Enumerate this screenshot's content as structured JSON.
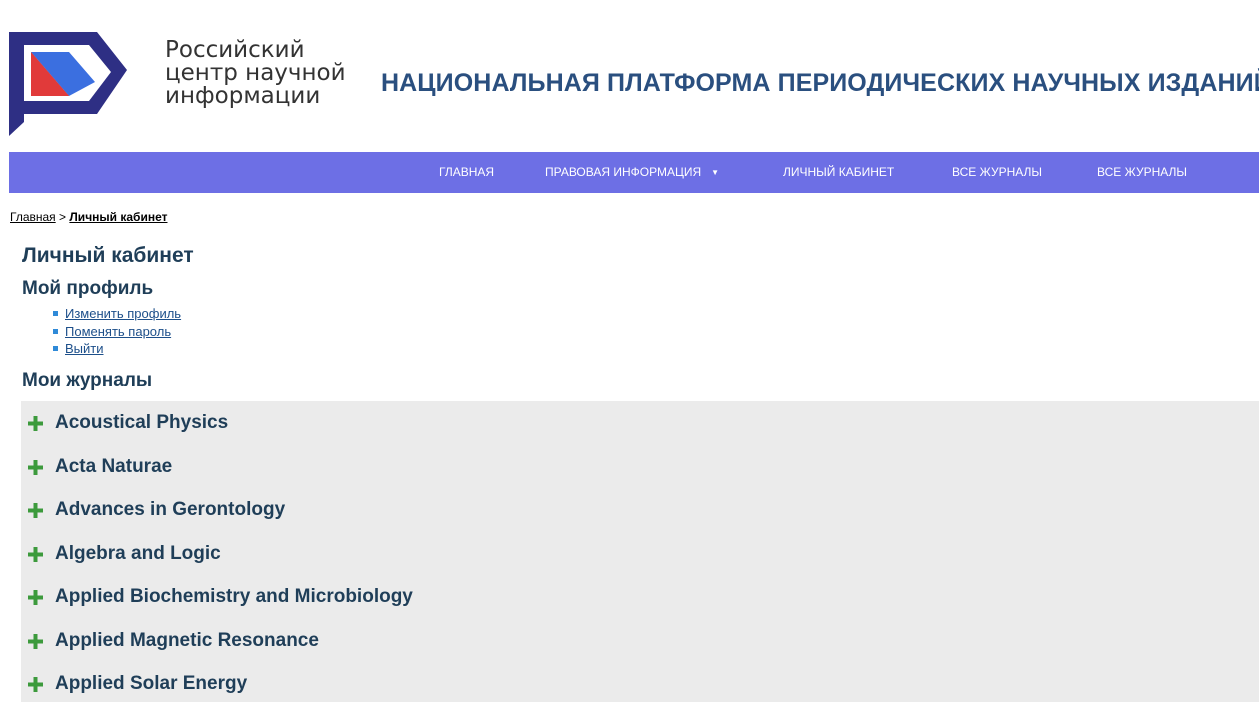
{
  "header": {
    "org_name_line1": "Российский",
    "org_name_line2": "центр научной",
    "org_name_line3": "информации",
    "platform_title": "НАЦИОНАЛЬНАЯ ПЛАТФОРМА ПЕРИОДИЧЕСКИХ НАУЧНЫХ ИЗДАНИЙ",
    "logo_icon": "rcsi-flag-logo"
  },
  "nav": {
    "items": [
      {
        "label": "ГЛАВНАЯ"
      },
      {
        "label": "ПРАВОВАЯ ИНФОРМАЦИЯ"
      },
      {
        "label": "ЛИЧНЫЙ КАБИНЕТ"
      },
      {
        "label": "ВСЕ ЖУРНАЛЫ"
      },
      {
        "label": "ВСЕ ЖУРНАЛЫ"
      }
    ],
    "dropdown_caret": "▼"
  },
  "breadcrumb": {
    "home": "Главная",
    "separator": ">",
    "current": "Личный кабинет"
  },
  "page": {
    "title": "Личный кабинет",
    "profile_title": "Мой профиль",
    "profile_links": [
      "Изменить профиль",
      "Поменять пароль",
      "Выйти"
    ],
    "journals_title": "Мои журналы"
  },
  "journals": [
    "Acoustical Physics",
    "Acta Naturae",
    "Advances in Gerontology",
    "Algebra and Logic",
    "Applied Biochemistry and Microbiology",
    "Applied Magnetic Resonance",
    "Applied Solar Energy"
  ],
  "colors": {
    "nav_background": "#6d6fe5",
    "title_color": "#2a4f7f",
    "heading_color": "#1f3e58",
    "journals_background": "#ebebeb",
    "plus_icon_color": "#3c9a3c",
    "logo_dark": "#2e2f84",
    "logo_blue": "#3b6fe0",
    "logo_red": "#e13a3a"
  }
}
